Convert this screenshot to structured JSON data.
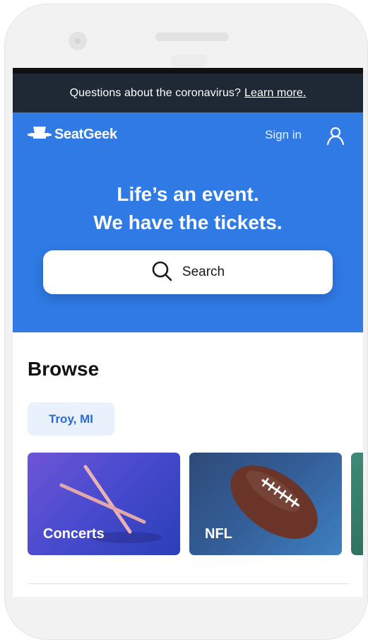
{
  "banner": {
    "text": "Questions about the coronavirus?",
    "link": "Learn more."
  },
  "header": {
    "brand": "SeatGeek",
    "sign_in": "Sign in"
  },
  "hero": {
    "headline_line1": "Life’s an event.",
    "headline_line2": "We have the tickets.",
    "search_label": "Search"
  },
  "browse": {
    "title": "Browse",
    "location": "Troy, MI",
    "categories": [
      {
        "label": "Concerts"
      },
      {
        "label": "NFL"
      },
      {
        "label": ""
      }
    ]
  },
  "colors": {
    "hero_bg": "#2f7ae5",
    "banner_bg": "#1f2935",
    "chip_bg": "#e9f1fc",
    "chip_text": "#2a6cd0"
  },
  "icons": [
    "seat-logo-icon",
    "user-icon",
    "search-icon",
    "drumsticks-icon",
    "football-icon"
  ]
}
